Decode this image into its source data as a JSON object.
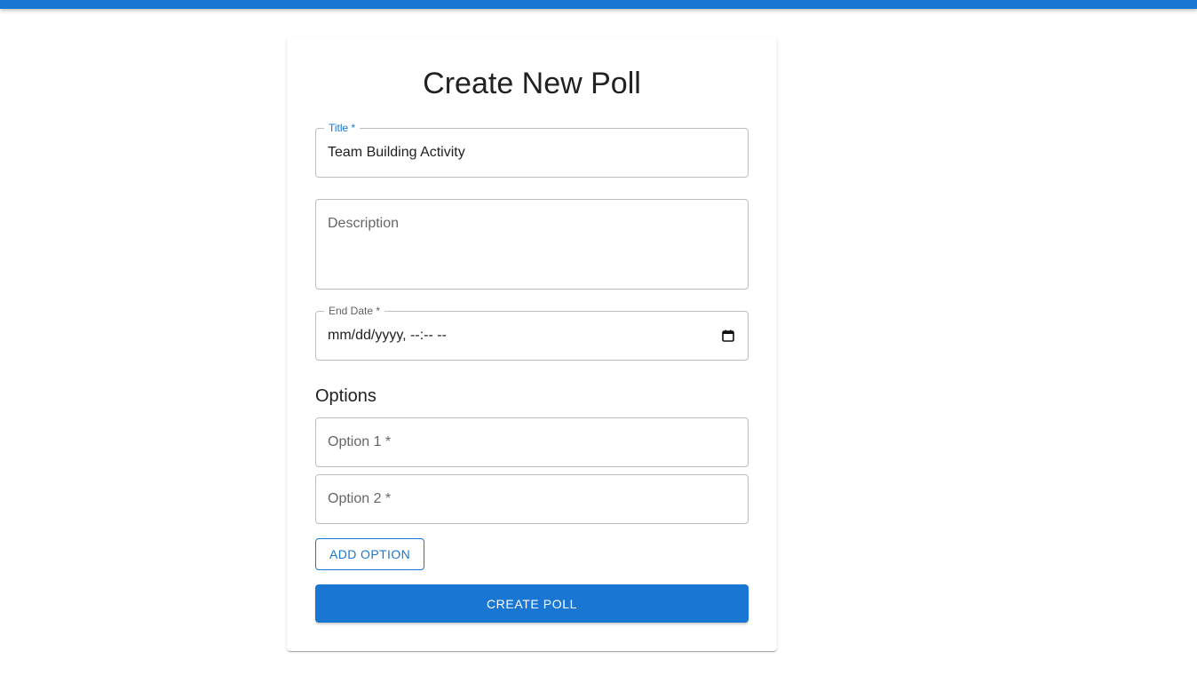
{
  "colors": {
    "primary": "#1976d2",
    "border": "#bdbdbd",
    "placeholder": "#666666",
    "text": "#212121"
  },
  "form": {
    "heading": "Create New Poll",
    "title_field": {
      "label": "Title *",
      "value": "Team Building Activity"
    },
    "description_field": {
      "placeholder": "Description",
      "value": ""
    },
    "end_date_field": {
      "label": "End Date *",
      "value": "mm/dd/yyyy, --:-- --",
      "icon": "calendar-icon"
    },
    "options_heading": "Options",
    "options": [
      {
        "placeholder": "Option 1 *",
        "value": ""
      },
      {
        "placeholder": "Option 2 *",
        "value": ""
      }
    ],
    "add_option_label": "ADD OPTION",
    "submit_label": "CREATE POLL"
  }
}
